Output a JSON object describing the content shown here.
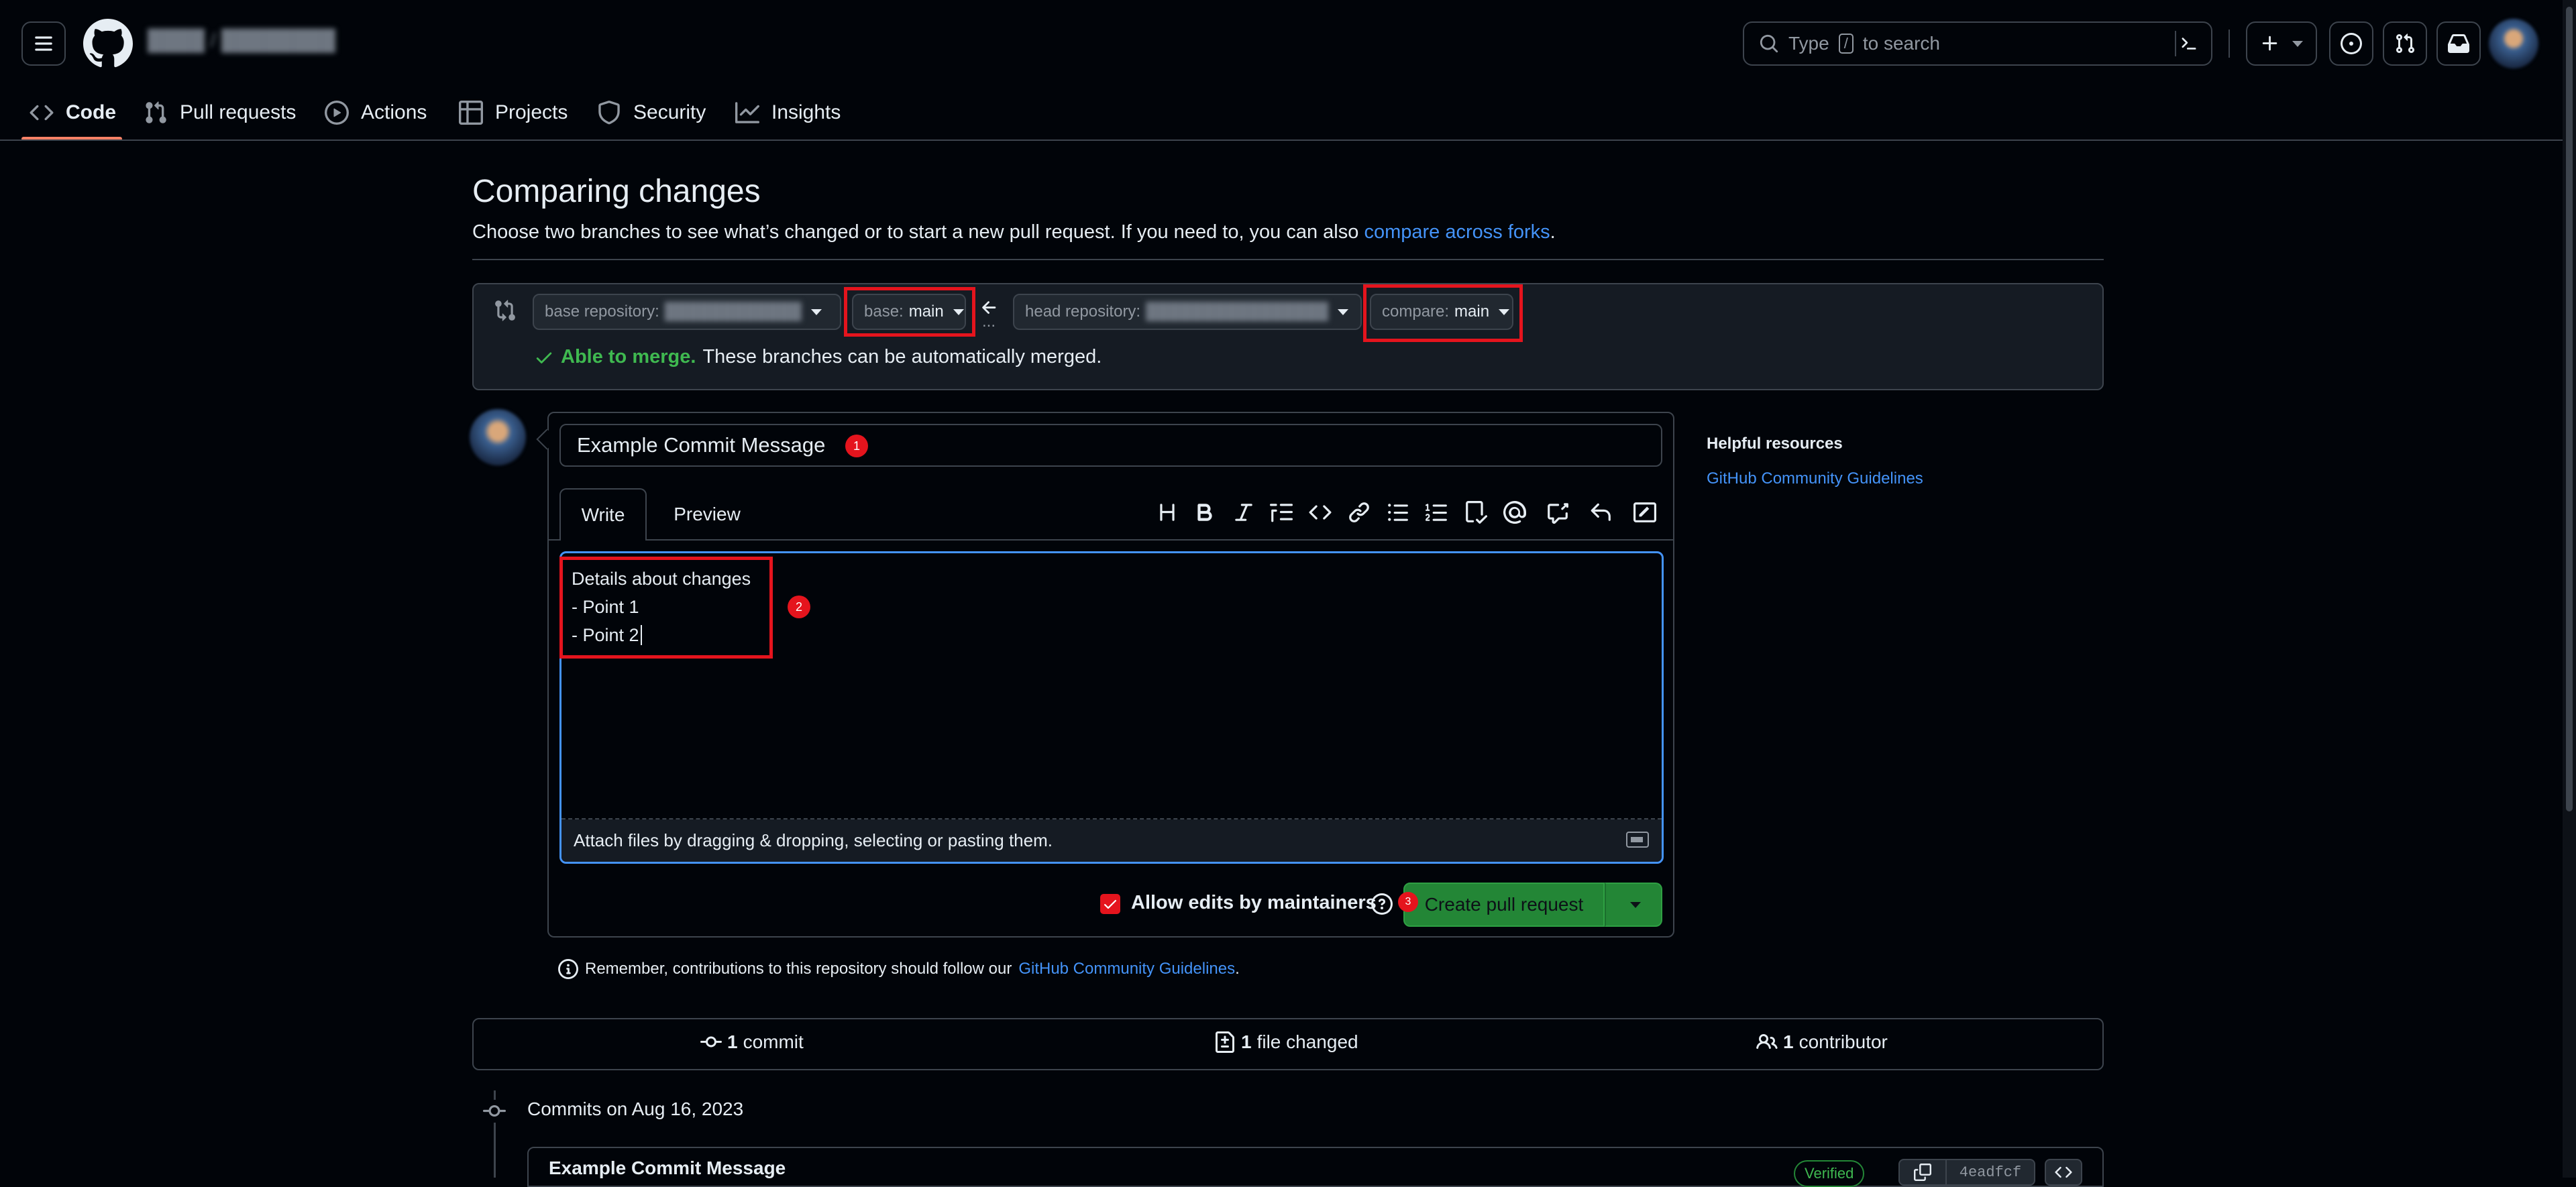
{
  "header": {
    "repo_path_blurred": "████ / ████████",
    "search_placeholder_pre": "Type",
    "search_key": "/",
    "search_placeholder_post": "to search"
  },
  "nav": {
    "tabs": [
      {
        "label": "Code",
        "icon": "code-icon",
        "active": true
      },
      {
        "label": "Pull requests",
        "icon": "pull-request-icon"
      },
      {
        "label": "Actions",
        "icon": "actions-play-icon"
      },
      {
        "label": "Projects",
        "icon": "projects-table-icon"
      },
      {
        "label": "Security",
        "icon": "shield-icon"
      },
      {
        "label": "Insights",
        "icon": "graph-icon"
      }
    ]
  },
  "compare": {
    "title": "Comparing changes",
    "description": "Choose two branches to see what’s changed or to start a new pull request. If you need to, you can also",
    "forks_link": "compare across forks",
    "period": ".",
    "base_repo_label": "base repository:",
    "base_repo_value": "████████████",
    "base_label": "base:",
    "base_value": "main",
    "head_repo_label": "head repository:",
    "head_repo_value": "████████████████",
    "compare_label": "compare:",
    "compare_value": "main",
    "merge_status": "Able to merge.",
    "merge_detail": "These branches can be automatically merged.",
    "ellipsis": "..."
  },
  "pr_form": {
    "title_value": "Example Commit Message",
    "tab_write": "Write",
    "tab_preview": "Preview",
    "body_lines": [
      "Details about changes",
      "- Point 1",
      "- Point 2"
    ],
    "attach_hint": "Attach files by dragging & dropping, selecting or pasting them.",
    "allow_edits_label": "Allow edits by maintainers",
    "create_button": "Create pull request",
    "markers": [
      "1",
      "2",
      "3"
    ]
  },
  "sidebar": {
    "heading": "Helpful resources",
    "link": "GitHub Community Guidelines"
  },
  "reminder": {
    "text": "Remember, contributions to this repository should follow our",
    "link": "GitHub Community Guidelines",
    "period": "."
  },
  "stats": {
    "commits_count": "1",
    "commits_label": "commit",
    "files_count": "1",
    "files_label": "file changed",
    "contributors_count": "1",
    "contributors_label": "contributor"
  },
  "commits": {
    "date_heading": "Commits on Aug 16, 2023",
    "first_title": "Example Commit Message",
    "verified": "Verified",
    "sha": "4eadfcf"
  },
  "colors": {
    "accent_blue": "#4493f8",
    "success_green": "#3fb950",
    "button_green": "#238636",
    "annotation_red": "#e5141d",
    "tab_underline": "#f78166"
  }
}
